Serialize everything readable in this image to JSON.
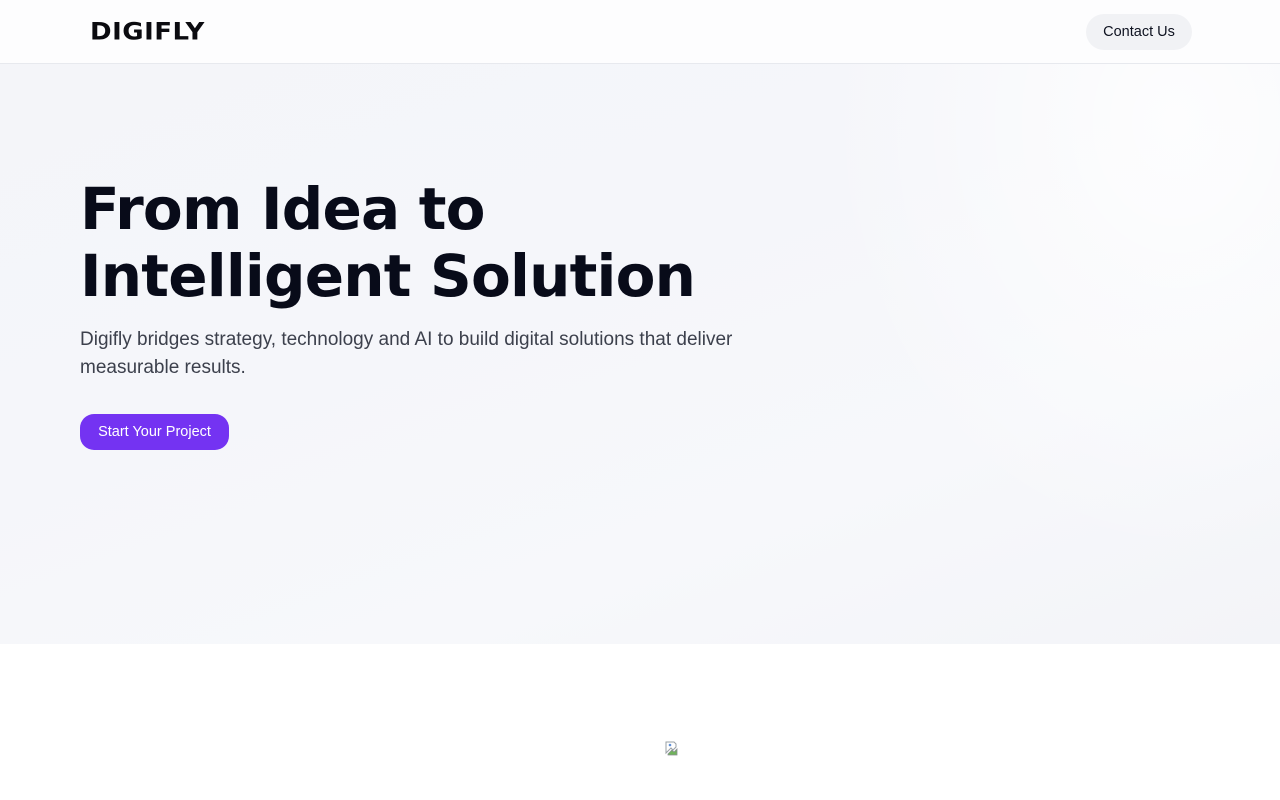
{
  "header": {
    "logo_text": "DIGIFLY",
    "contact_label": "Contact Us"
  },
  "hero": {
    "title": "From Idea to Intelligent Solution",
    "subtitle": "Digifly bridges strategy, technology and AI to build digital solutions that deliver measurable results.",
    "cta_label": "Start Your Project"
  },
  "colors": {
    "accent": "#7433f2",
    "hero_bg": "#f4f5f9",
    "title": "#080b19",
    "body_text": "#3c404c",
    "contact_bg": "#f1f2f5"
  },
  "lower_section": {
    "image_icon": "broken-image-icon"
  }
}
